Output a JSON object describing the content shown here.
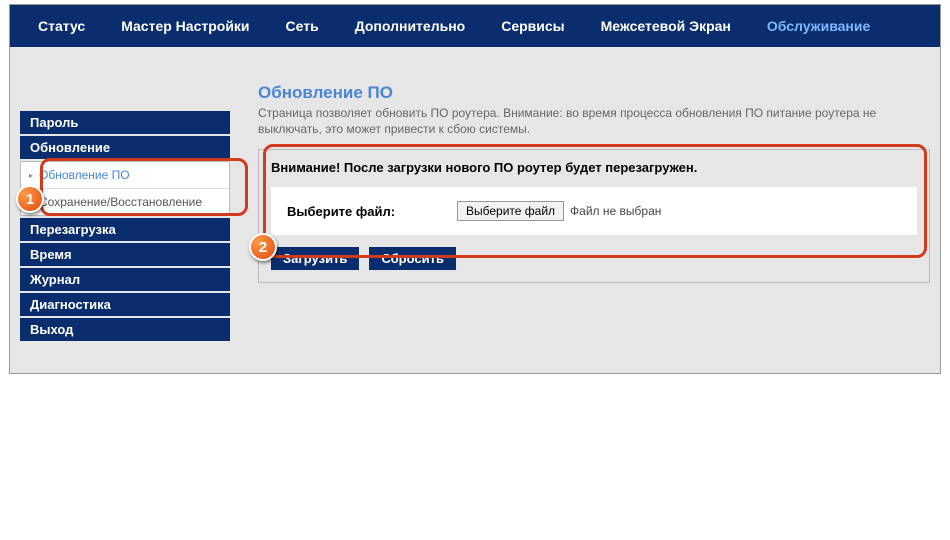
{
  "topnav": {
    "items": [
      {
        "label": "Статус"
      },
      {
        "label": "Мастер Настройки"
      },
      {
        "label": "Сеть"
      },
      {
        "label": "Дополнительно"
      },
      {
        "label": "Сервисы"
      },
      {
        "label": "Межсетевой Экран"
      },
      {
        "label": "Обслуживание"
      }
    ]
  },
  "sidebar": {
    "items": [
      {
        "label": "Пароль"
      },
      {
        "label": "Обновление"
      },
      {
        "label": "Перезагрузка"
      },
      {
        "label": "Время"
      },
      {
        "label": "Журнал"
      },
      {
        "label": "Диагностика"
      },
      {
        "label": "Выход"
      }
    ],
    "sub": [
      {
        "label": "Обновление ПО"
      },
      {
        "label": "Сохранение/Восстановление"
      }
    ]
  },
  "page": {
    "title": "Обновление ПО",
    "desc": "Страница позволяет обновить ПО роутера. Внимание: во время процесса обновления ПО питание роутера не выключать, это может привести к сбою системы.",
    "warning": "Внимание! После загрузки нового ПО роутер будет перезагружен.",
    "file_label": "Выберите файл:",
    "file_button": "Выберите файл",
    "file_status": "Файл не выбран",
    "upload": "Загрузить",
    "reset": "Сбросить"
  },
  "annotations": {
    "one": "1",
    "two": "2"
  }
}
